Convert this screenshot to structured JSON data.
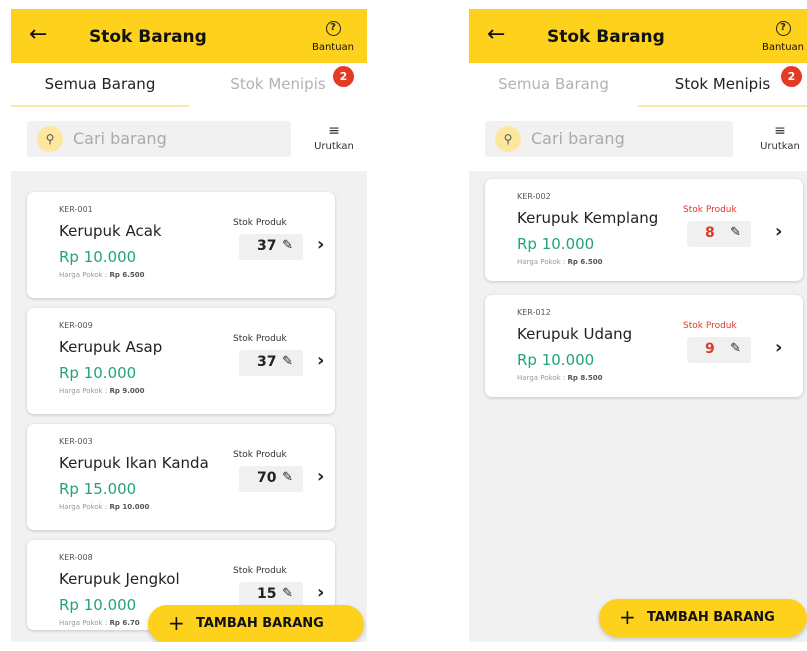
{
  "left": {
    "title": "Stok Barang",
    "help_label": "Bantuan",
    "tabs": [
      {
        "label": "Semua Barang"
      },
      {
        "label": "Stok Menipis",
        "badge": "2"
      }
    ],
    "search_placeholder": "Cari barang",
    "sort_label": "Urutkan",
    "items": [
      {
        "code": "KER-001",
        "name": "Kerupuk Acak",
        "price": "Rp 10.000",
        "cost_label": "Harga Pokok :",
        "cost": "Rp 6.500",
        "stock_label": "Stok Produk",
        "stock": "37"
      },
      {
        "code": "KER-009",
        "name": "Kerupuk Asap",
        "price": "Rp 10.000",
        "cost_label": "Harga Pokok :",
        "cost": "Rp 9.000",
        "stock_label": "Stok Produk",
        "stock": "37"
      },
      {
        "code": "KER-003",
        "name": "Kerupuk Ikan Kanda",
        "price": "Rp 15.000",
        "cost_label": "Harga Pokok :",
        "cost": "Rp 10.000",
        "stock_label": "Stok Produk",
        "stock": "70"
      },
      {
        "code": "KER-008",
        "name": "Kerupuk Jengkol",
        "price": "Rp 10.000",
        "cost_label": "Harga Pokok :",
        "cost": "Rp 6.70",
        "stock_label": "Stok Produk",
        "stock": "15"
      }
    ],
    "fab_label": "TAMBAH BARANG"
  },
  "right": {
    "title": "Stok Barang",
    "help_label": "Bantuan",
    "tabs": [
      {
        "label": "Semua Barang"
      },
      {
        "label": "Stok Menipis",
        "badge": "2"
      }
    ],
    "search_placeholder": "Cari barang",
    "sort_label": "Urutkan",
    "items": [
      {
        "code": "KER-002",
        "name": "Kerupuk Kemplang",
        "price": "Rp 10.000",
        "cost_label": "Harga Pokok :",
        "cost": "Rp 6.500",
        "stock_label": "Stok Produk",
        "stock": "8"
      },
      {
        "code": "KER-012",
        "name": "Kerupuk Udang",
        "price": "Rp 10.000",
        "cost_label": "Harga Pokok :",
        "cost": "Rp 8.500",
        "stock_label": "Stok Produk",
        "stock": "9"
      }
    ],
    "fab_label": "TAMBAH BARANG"
  },
  "colors": {
    "brand_yellow": "#fed11c",
    "price_green": "#21a37b",
    "alert_red": "#d93b2b",
    "badge_red": "#e23a24"
  },
  "icons": {
    "back": "arrow-left-icon",
    "help": "question-circle-icon",
    "search": "search-icon",
    "sort": "sort-lines-icon",
    "edit": "pencil-icon",
    "open": "chevron-right-icon",
    "add": "plus-icon"
  }
}
